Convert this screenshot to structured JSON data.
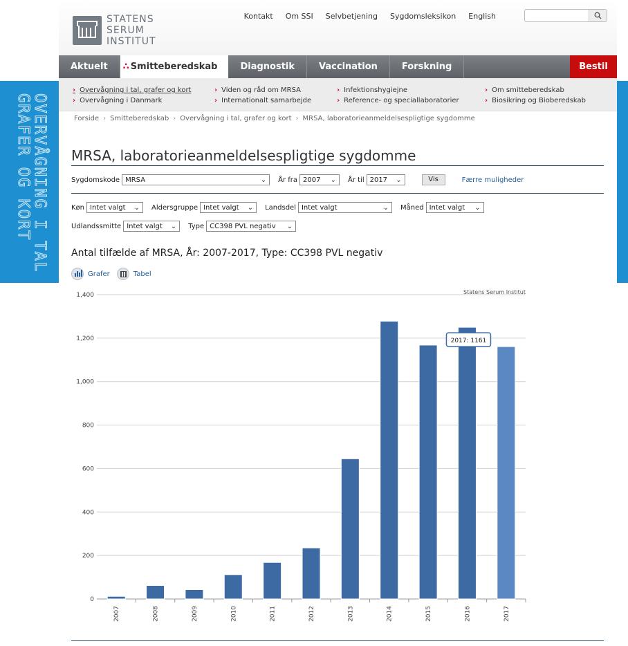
{
  "side_banner": {
    "line1": "OVERVÅGNING I TAL",
    "line2": "GRAFER OG KORT"
  },
  "header": {
    "logo_lines": [
      "STATENS",
      "SERUM",
      "INSTITUT"
    ],
    "top_links": [
      "Kontakt",
      "Om SSI",
      "Selvbetjening",
      "Sygdomsleksikon",
      "English"
    ],
    "search_placeholder": "",
    "search_icon": "magnifier-icon"
  },
  "nav": {
    "items": [
      "Aktuelt",
      "Smitteberedskab",
      "Diagnostik",
      "Vaccination",
      "Forskning"
    ],
    "active_index": 1,
    "bestil": "Bestil"
  },
  "subnav": {
    "col1": [
      "Overvågning i tal, grafer og kort",
      "Overvågning i Danmark"
    ],
    "col2": [
      "Viden og råd om MRSA",
      "Internationalt samarbejde"
    ],
    "col3": [
      "Infektionshygiejne",
      "Reference- og speciallaboratorier"
    ],
    "col4": [
      "Om smitteberedskab",
      "Biosikring og Bioberedskab"
    ]
  },
  "breadcrumb": [
    "Forside",
    "Smitteberedskab",
    "Overvågning i tal, grafer og kort",
    "MRSA, laboratorieanmeldelsespligtige sygdomme"
  ],
  "page_title": "MRSA, laboratorieanmeldelsespligtige sygdomme",
  "filters": {
    "sygdomskode_label": "Sygdomskode",
    "sygdomskode_value": "MRSA",
    "aar_fra_label": "År fra",
    "aar_fra_value": "2007",
    "aar_til_label": "År til",
    "aar_til_value": "2017",
    "vis_button": "Vis",
    "faerre_link": "Færre muligheder",
    "koen_label": "Køn",
    "koen_value": "Intet valgt",
    "aldersgruppe_label": "Aldersgruppe",
    "aldersgruppe_value": "Intet valgt",
    "landsdel_label": "Landsdel",
    "landsdel_value": "Intet valgt",
    "maaned_label": "Måned",
    "maaned_value": "Intet valgt",
    "udlandssmitte_label": "Udlandssmitte",
    "udlandssmitte_value": "Intet valgt",
    "type_label": "Type",
    "type_value": "CC398 PVL negativ"
  },
  "chart_heading": "Antal tilfælde af MRSA, År: 2007-2017, Type: CC398 PVL negativ",
  "view_toggle": {
    "grafer": "Grafer",
    "tabel": "Tabel"
  },
  "chart_data": {
    "type": "bar",
    "credit": "Statens Serum Institut",
    "categories": [
      "2007",
      "2008",
      "2009",
      "2010",
      "2011",
      "2012",
      "2013",
      "2014",
      "2015",
      "2016",
      "2017"
    ],
    "values": [
      12,
      62,
      43,
      112,
      168,
      235,
      645,
      1278,
      1168,
      1250,
      1161
    ],
    "ylim": [
      0,
      1400
    ],
    "yticks": [
      "0",
      "200",
      "400",
      "600",
      "800",
      "1,000",
      "1,200",
      "1,400"
    ],
    "grid": true,
    "bar_color": "#3d6aa3",
    "highlight_color": "#5b88c2",
    "highlight_index": 10,
    "tooltip": "2017: 1161"
  }
}
